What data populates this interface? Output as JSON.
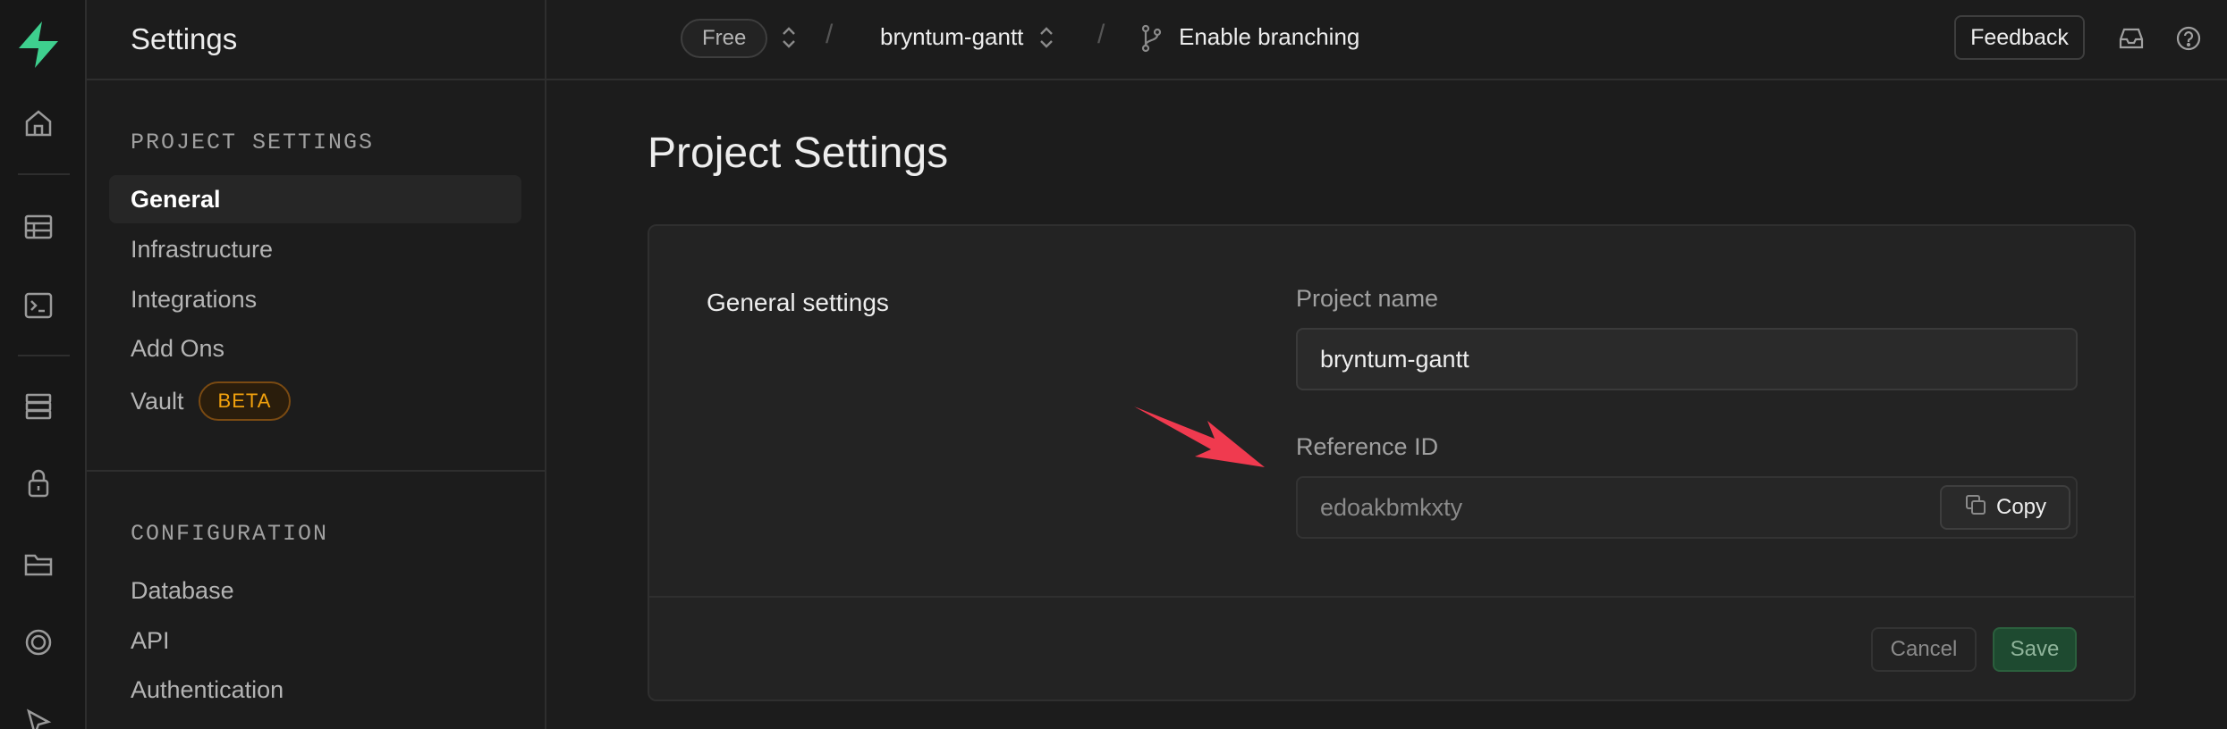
{
  "header": {
    "sidebar_title": "Settings",
    "plan_badge": "Free",
    "project_selector": "bryntum-gantt",
    "branching_label": "Enable branching",
    "feedback_label": "Feedback"
  },
  "rail": {
    "icons": [
      "home-icon",
      "table-editor-icon",
      "sql-editor-icon",
      "database-icon",
      "auth-lock-icon",
      "storage-icon",
      "realtime-icon",
      "cursor-icon"
    ]
  },
  "sidebar": {
    "project_settings_title": "PROJECT SETTINGS",
    "items": [
      {
        "label": "General"
      },
      {
        "label": "Infrastructure"
      },
      {
        "label": "Integrations"
      },
      {
        "label": "Add Ons"
      },
      {
        "label": "Vault",
        "badge": "BETA"
      }
    ],
    "configuration_title": "CONFIGURATION",
    "config_items": [
      {
        "label": "Database"
      },
      {
        "label": "API"
      },
      {
        "label": "Authentication"
      }
    ]
  },
  "main": {
    "page_title": "Project Settings",
    "section_label": "General settings",
    "project_name_label": "Project name",
    "project_name_value": "bryntum-gantt",
    "reference_id_label": "Reference ID",
    "reference_id_value": "edoakbmkxty",
    "copy_label": "Copy",
    "cancel_label": "Cancel",
    "save_label": "Save"
  },
  "colors": {
    "brand": "#3ecf8e",
    "background": "#1c1c1c",
    "beta_badge": "#f1a10d",
    "annotation_arrow": "#f03a4f"
  }
}
